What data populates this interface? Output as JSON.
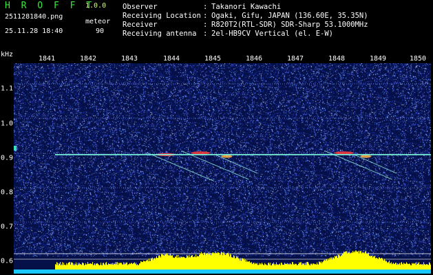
{
  "header": {
    "app_title": "H R O F F T",
    "version": "1.0.0",
    "filename": "2511281840.png",
    "mode": "meteor",
    "datetime": "25.11.28 18:40",
    "count": "90"
  },
  "info": [
    {
      "label": "Observer",
      "value": "Takanori Kawachi"
    },
    {
      "label": "Receiving Location",
      "value": "Ogaki, Gifu, JAPAN (136.60E, 35.35N)"
    },
    {
      "label": "Receiver",
      "value": "R820T2(RTL-SDR) SDR-Sharp 53.1000MHz"
    },
    {
      "label": "Receiving antenna",
      "value": "2el-HB9CV Vertical (el. E-W)"
    }
  ],
  "info_separator": ":",
  "axis": {
    "y_unit": "kHz",
    "x_ticks": [
      "1841",
      "1842",
      "1843",
      "1844",
      "1845",
      "1846",
      "1847",
      "1848",
      "1849",
      "1850"
    ],
    "y_ticks": [
      "1.1",
      "1.0",
      "0.9",
      "0.8",
      "0.7",
      "0.6"
    ]
  },
  "chart_data": {
    "type": "heatmap",
    "x_unit": "HHMM (JST)",
    "y_unit": "kHz",
    "xlim": [
      "1840.7",
      "1850.3"
    ],
    "ylim": [
      0.58,
      1.19
    ],
    "carrier_khz": 0.925,
    "meteor_echoes": [
      {
        "time": "1844.2",
        "freq_khz": 0.925,
        "strength": "strong"
      },
      {
        "time": "1845.0",
        "freq_khz": 0.93,
        "strength": "strong"
      },
      {
        "time": "1845.6",
        "freq_khz": 0.92,
        "strength": "medium"
      },
      {
        "time": "1848.3",
        "freq_khz": 0.93,
        "strength": "strong"
      },
      {
        "time": "1848.8",
        "freq_khz": 0.92,
        "strength": "medium"
      }
    ],
    "colors": {
      "background": "#041047",
      "noise": "#5a78ff",
      "carrier": "#7dffe0",
      "echo_hot": "#ff3a3a",
      "level_bar": "#ffff00",
      "level_base": "#18c8ff"
    }
  }
}
